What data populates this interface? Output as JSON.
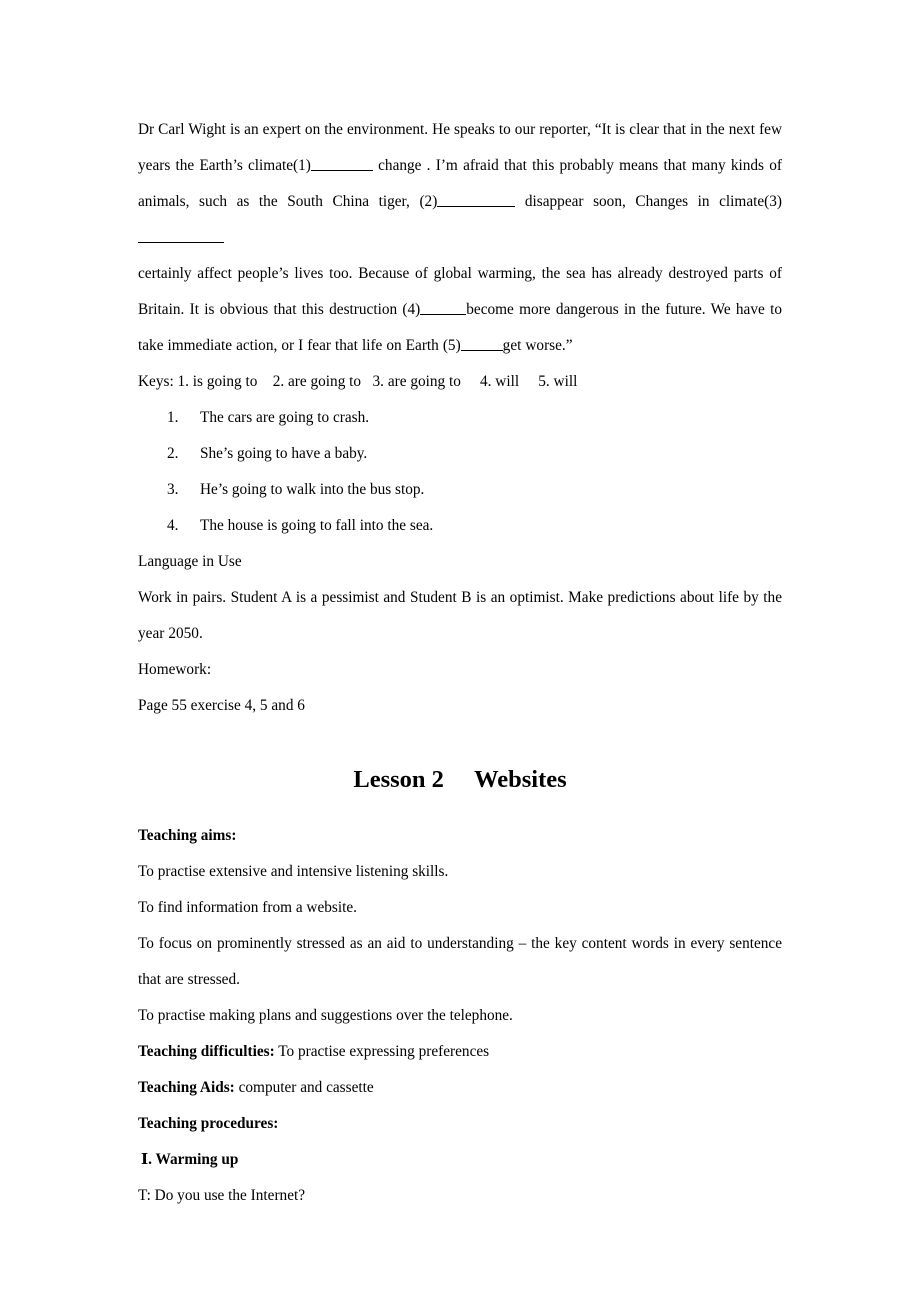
{
  "document": {
    "paragraph_1": {
      "part_a": "Dr Carl Wight is an expert on the environment. He speaks to our reporter, “It is clear that in the next few years the Earth’s climate(1)",
      "part_b": "change . I’m afraid that this probably means that many kinds of animals, such as the South China tiger, (2)",
      "part_c": "disappear soon, Changes in climate(3)"
    },
    "paragraph_2": {
      "part_a": "certainly affect people’s lives too. Because of global warming, the sea has already destroyed parts of Britain. It is obvious that this destruction (4)",
      "part_b": "become more dangerous in the future. We have to take immediate action, or I fear that life on Earth (5)",
      "part_c": "get worse.”"
    },
    "keys_line": "Keys: 1. is going to    2. are going to   3. are going to     4. will     5. will",
    "numbered_list": [
      {
        "num": "1.",
        "text": "The cars are going to crash."
      },
      {
        "num": "2.",
        "text": "She’s going to have a baby."
      },
      {
        "num": "3.",
        "text": "He’s going to walk into the bus stop."
      },
      {
        "num": "4.",
        "text": "The house is going to fall into the sea."
      }
    ],
    "language_in_use_heading": "Language in Use",
    "language_in_use_body": "Work in pairs. Student A is a pessimist and Student B is an optimist. Make predictions about life by the year 2050.",
    "homework_heading": "Homework:",
    "homework_body": "Page 55 exercise 4, 5 and 6",
    "lesson_title": "Lesson 2  Websites",
    "teaching_aims_label": "Teaching aims:",
    "teaching_aims": [
      "To practise extensive and intensive listening skills.",
      "To find information from a website.",
      "To focus on prominently stressed as an aid to understanding – the key content words in every sentence that are stressed.",
      "To practise making plans and suggestions over the telephone."
    ],
    "teaching_difficulties_label": "Teaching difficulties:",
    "teaching_difficulties_value": " To practise expressing preferences",
    "teaching_aids_label": "Teaching Aids:",
    "teaching_aids_value": " computer and cassette",
    "teaching_procedures_label": "Teaching procedures:",
    "section_warming_up": "Ⅰ. Warming up",
    "warming_up_line": "T: Do you use the Internet?"
  }
}
